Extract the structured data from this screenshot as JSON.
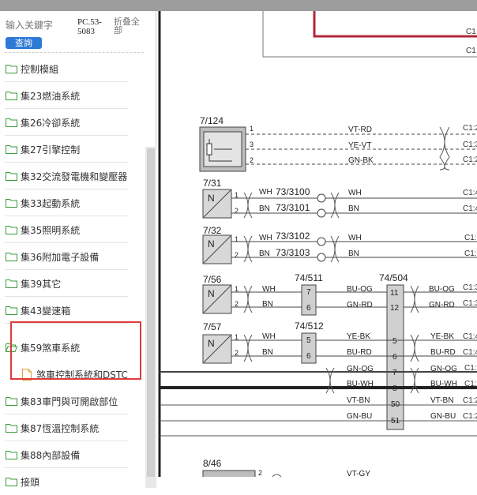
{
  "search": {
    "placeholder": "输入关鍵字",
    "button_label": "查詢"
  },
  "doc_id": "PC.53-5083",
  "collapse_label": "折叠全部",
  "tree": [
    {
      "label": "控制模組",
      "type": "folder"
    },
    {
      "label": "集23燃油系統",
      "type": "folder"
    },
    {
      "label": "集26冷卻系統",
      "type": "folder"
    },
    {
      "label": "集27引擎控制",
      "type": "folder"
    },
    {
      "label": "集32交流發電機和變壓器",
      "type": "folder"
    },
    {
      "label": "集33起動系統",
      "type": "folder"
    },
    {
      "label": "集35照明系統",
      "type": "folder"
    },
    {
      "label": "集36附加電子設備",
      "type": "folder"
    },
    {
      "label": "集39其它",
      "type": "folder"
    },
    {
      "label": "集43變速箱",
      "type": "folder"
    },
    {
      "label": "集59煞車系統",
      "type": "folder-open"
    },
    {
      "label": "煞車控制系統和DSTC",
      "type": "document"
    },
    {
      "label": "集83車門與可開啟部位",
      "type": "folder"
    },
    {
      "label": "集87恆溫控制系統",
      "type": "folder"
    },
    {
      "label": "集88內部設備",
      "type": "folder"
    },
    {
      "label": "接頭",
      "type": "folder"
    }
  ],
  "schematic": {
    "components": [
      "7/124",
      "7/31",
      "7/32",
      "7/56",
      "7/57",
      "74/511",
      "74/512",
      "74/504",
      "8/46"
    ],
    "connectors": [
      "73/3100",
      "73/3101",
      "73/3102",
      "73/3103"
    ],
    "sensor_symbol": "N",
    "wires": {
      "c7_124": [
        "VT-RD",
        "YE-VT",
        "GN-BK"
      ],
      "c7_31": [
        "WH",
        "BN",
        "WH",
        "BN"
      ],
      "c7_32": [
        "WH",
        "BN",
        "WH",
        "BN"
      ],
      "c7_56_left": [
        "WH",
        "BN"
      ],
      "c7_56_mid": [
        "BU-OG",
        "GN-RD"
      ],
      "c7_56_right": [
        "BU-OG",
        "GN-RD"
      ],
      "c7_57_left": [
        "WH",
        "BN"
      ],
      "c7_57_mid": [
        "YE-BK",
        "BU-RD",
        "GN-OG",
        "BU-WH",
        "VT-BN",
        "GN-BU"
      ],
      "c7_57_right": [
        "YE-BK",
        "BU-RD",
        "GN-OG",
        "BU-WH",
        "VT-BN",
        "GN-BU"
      ],
      "c8_46": [
        "VT-GY"
      ]
    },
    "pins": {
      "p7_124": [
        "1",
        "3",
        "2"
      ],
      "p7_31": [
        "1",
        "2"
      ],
      "p7_32": [
        "1",
        "2"
      ],
      "p7_56": [
        "1",
        "2"
      ],
      "p7_57": [
        "1",
        "2"
      ],
      "p74_511": [
        "7",
        "6"
      ],
      "p74_512": [
        "5",
        "6"
      ],
      "p74_504": [
        "11",
        "12",
        "5",
        "6",
        "7",
        "8",
        "50",
        "51"
      ],
      "p8_46": [
        "2"
      ]
    },
    "edge_labels": [
      "C1",
      "C1",
      "C1:2",
      "C1:3",
      "C1:2",
      "C1:4",
      "C1:4",
      "C1:",
      "C1:",
      "C1:3",
      "C1:3",
      "C1:4",
      "C1:4",
      "C1:",
      "C1:",
      "C1:2",
      "C1:2"
    ]
  }
}
